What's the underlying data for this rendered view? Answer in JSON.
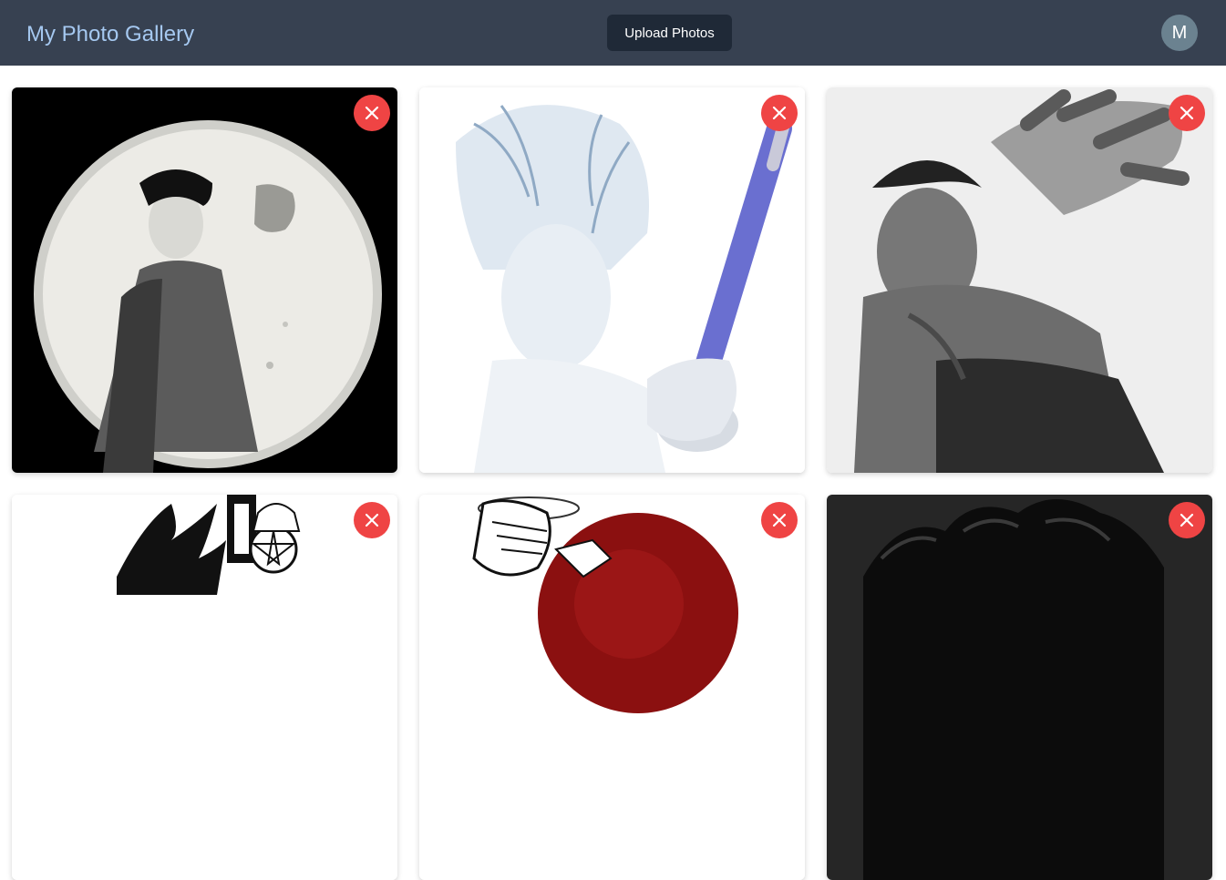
{
  "header": {
    "title": "My Photo Gallery",
    "upload_label": "Upload Photos",
    "avatar_initial": "M"
  },
  "colors": {
    "header_bg": "#374151",
    "title_color": "#a5c8f0",
    "upload_bg": "#1f2937",
    "avatar_bg": "#6b8290",
    "delete_bg": "#ef4444"
  },
  "gallery": {
    "photos": [
      {
        "icon": "close-icon"
      },
      {
        "icon": "close-icon"
      },
      {
        "icon": "close-icon"
      },
      {
        "icon": "close-icon"
      },
      {
        "icon": "close-icon"
      },
      {
        "icon": "close-icon"
      }
    ]
  }
}
